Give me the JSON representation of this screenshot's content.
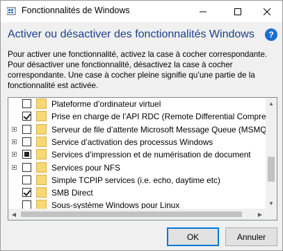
{
  "window": {
    "title": "Fonctionnalités de Windows",
    "controls": {
      "minimize": "—",
      "maximize": "☐",
      "close": "✕"
    }
  },
  "header": {
    "title": "Activer ou désactiver des fonctionnalités Windows",
    "help_icon": "?"
  },
  "description": "Pour activer une fonctionnalité, activez la case à cocher correspondante. Pour désactiver une fonctionnalité, désactivez la case à cocher correspondante. Une case à cocher pleine signifie qu’une partie de la fonctionnalité est activée.",
  "features": [
    {
      "label": "Plateforme d’ordinateur virtuel",
      "state": "unchecked",
      "expandable": false
    },
    {
      "label": "Prise en charge de l’API RDC (Remote Differential Compressi",
      "state": "checked",
      "expandable": false
    },
    {
      "label": "Serveur de file d’attente Microsoft Message Queue (MSMQ)",
      "state": "unchecked",
      "expandable": true
    },
    {
      "label": "Service d’activation des processus Windows",
      "state": "unchecked",
      "expandable": true
    },
    {
      "label": "Services d’impression et de numérisation de document",
      "state": "partial",
      "expandable": true
    },
    {
      "label": "Services pour NFS",
      "state": "unchecked",
      "expandable": true
    },
    {
      "label": "Simple TCPIP services (i.e. echo, daytime etc)",
      "state": "unchecked",
      "expandable": false
    },
    {
      "label": "SMB Direct",
      "state": "checked",
      "expandable": false
    },
    {
      "label": "Sous-système Windows pour Linux",
      "state": "unchecked",
      "expandable": false
    }
  ],
  "buttons": {
    "ok": "OK",
    "cancel": "Annuler"
  },
  "colors": {
    "header_title": "#1e3f8a",
    "accent": "#0078d7",
    "folder": "#f8d775"
  }
}
